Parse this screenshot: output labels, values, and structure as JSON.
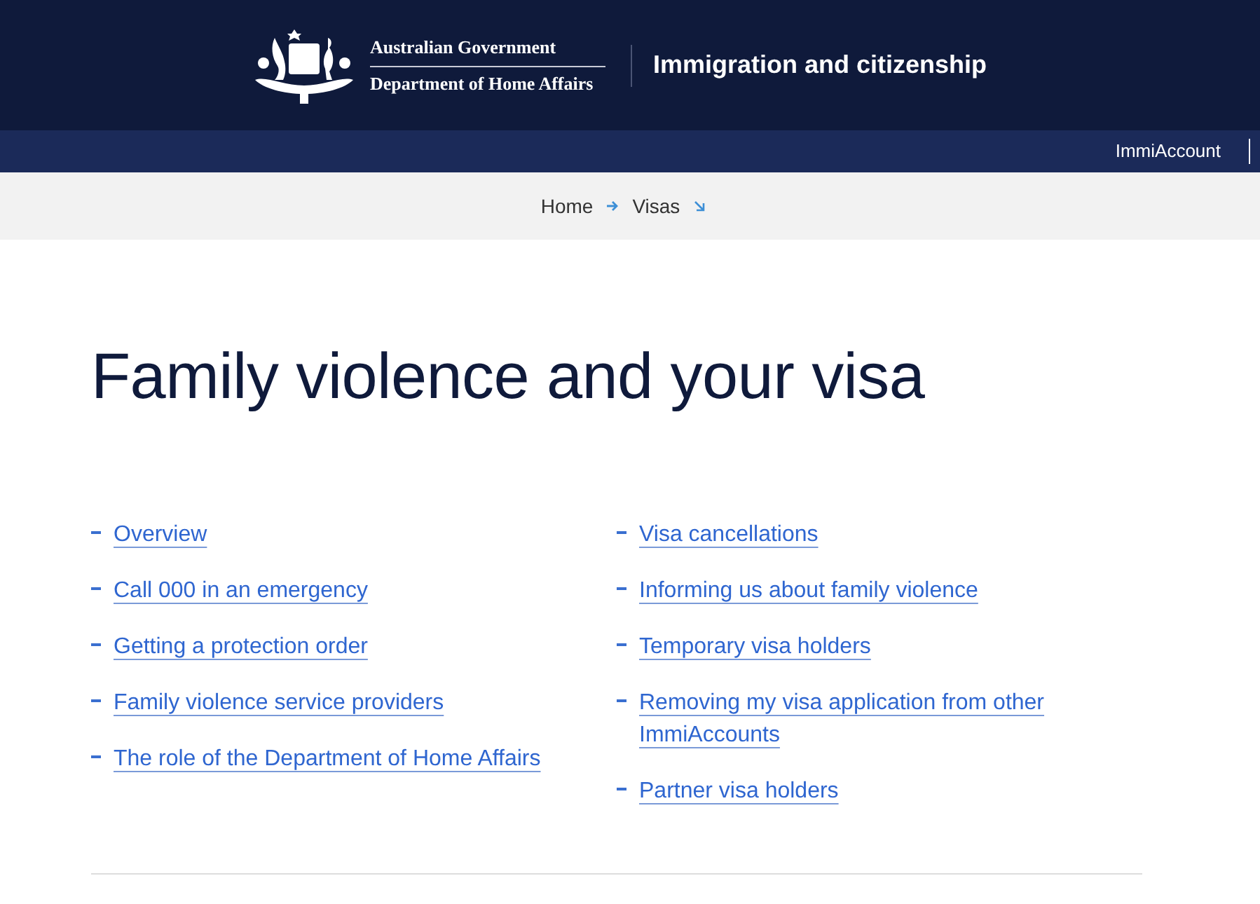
{
  "header": {
    "agency_line_1": "Australian Government",
    "agency_line_2": "Department of Home Affairs",
    "site_title": "Immigration and citizenship"
  },
  "top_nav": {
    "links": [
      "ImmiAccount"
    ]
  },
  "breadcrumb": {
    "items": [
      "Home",
      "Visas"
    ]
  },
  "page_title": "Family violence and your visa",
  "contents": {
    "columns": [
      [
        "Overview",
        "Call 000 in an emergency",
        "Getting a protection order",
        "Family violence service providers",
        "The role of the Department of Home Affairs"
      ],
      [
        "Visa cancellations",
        "Informing us about family violence",
        "Temporary visa holders",
        "Removing my visa application from other ImmiAccounts",
        "Partner visa holders"
      ]
    ]
  }
}
